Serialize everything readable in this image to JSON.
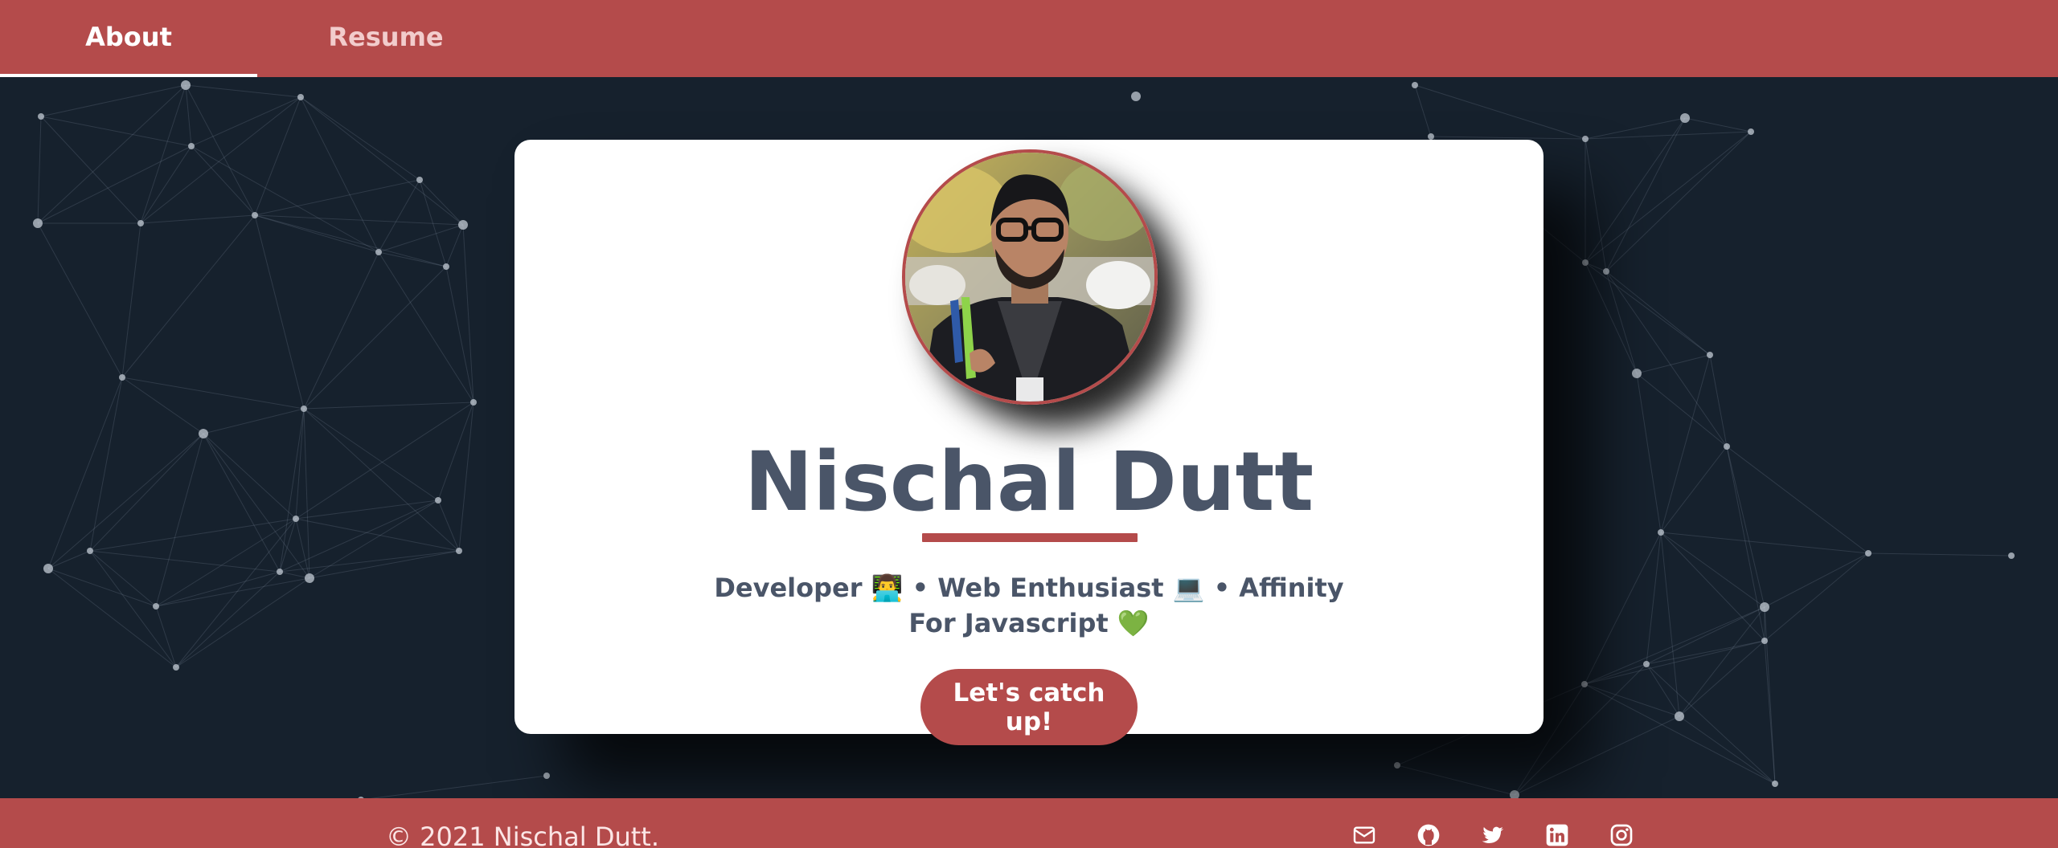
{
  "nav": {
    "tabs": [
      {
        "label": "About",
        "active": true
      },
      {
        "label": "Resume",
        "active": false
      }
    ]
  },
  "profile": {
    "name": "Nischal Dutt",
    "tagline": "Developer 👨‍💻 • Web Enthusiast 💻 • Affinity For Javascript 💚",
    "cta_label": "Let's catch up!"
  },
  "footer": {
    "copyright": "© 2021 Nischal Dutt.",
    "social_icons": [
      "mail-icon",
      "github-icon",
      "twitter-icon",
      "linkedin-icon",
      "instagram-icon"
    ]
  },
  "colors": {
    "brand": "#b44b4b",
    "background": "#16212d",
    "text": "#4a5568",
    "card": "#ffffff"
  }
}
